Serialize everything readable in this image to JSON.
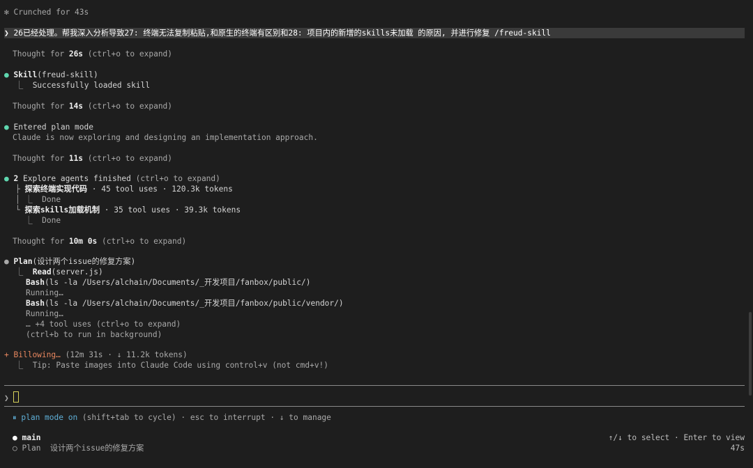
{
  "status_top": {
    "icon": "✻",
    "text": "Crunched for 43s"
  },
  "user_prompt": {
    "prompt_symbol": "❯",
    "text": "26已经处理。帮我深入分析导致27: 终端无法复制粘贴,和原生的终端有区别和28: 项目内的新增的skills未加载 的原因, 并进行修复 /freud-skill"
  },
  "thought1": {
    "pre": "Thought for ",
    "dur": "26s",
    "post": " (ctrl+o to expand)"
  },
  "skill": {
    "bullet": "●",
    "name": "Skill",
    "arg": "(freud-skill)",
    "result": "Successfully loaded skill"
  },
  "thought2": {
    "pre": "Thought for ",
    "dur": "14s",
    "post": " (ctrl+o to expand)"
  },
  "plan_mode": {
    "bullet": "●",
    "title": "Entered plan mode",
    "desc": "Claude is now exploring and designing an implementation approach."
  },
  "thought3": {
    "pre": "Thought for ",
    "dur": "11s",
    "post": " (ctrl+o to expand)"
  },
  "agents": {
    "bullet": "●",
    "count": "2",
    "title": " Explore agents finished",
    "hint": " (ctrl+o to expand)",
    "items": [
      {
        "name": "探索终端实现代码",
        "stats": " · 45 tool uses · 120.3k tokens",
        "status": "Done"
      },
      {
        "name": "探索skills加载机制",
        "stats": " · 35 tool uses · 39.3k tokens",
        "status": "Done"
      }
    ]
  },
  "thought4": {
    "pre": "Thought for ",
    "dur": "10m 0s",
    "post": " (ctrl+o to expand)"
  },
  "plan": {
    "bullet": "●",
    "name": "Plan",
    "arg": "(设计两个issue的修复方案)",
    "steps": [
      {
        "tool": "Read",
        "arg": "(server.js)"
      },
      {
        "tool": "Bash",
        "arg": "(ls -la /Users/alchain/Documents/_开发项目/fanbox/public/)"
      },
      {
        "status": "Running…"
      },
      {
        "tool": "Bash",
        "arg": "(ls -la /Users/alchain/Documents/_开发项目/fanbox/public/vendor/)"
      },
      {
        "status": "Running…"
      }
    ],
    "more": "… +4 tool uses (ctrl+o to expand)",
    "background": "(ctrl+b to run in background)"
  },
  "spinner": {
    "icon": "+",
    "word": "Billowing…",
    "stats": " (12m 31s · ↓ 11.2k tokens)",
    "tip": "Tip: Paste images into Claude Code using control+v (not cmd+v!)"
  },
  "input": {
    "prompt_symbol": "❯"
  },
  "mode_line": {
    "icon": "⏸",
    "mode": "plan mode on",
    "hint": " (shift+tab to cycle) · esc to interrupt · ↓ to manage"
  },
  "tasks": {
    "main_bullet": "●",
    "main_label": "main",
    "plan_bullet": "○",
    "plan_label": "Plan  设计两个issue的修复方案",
    "select_hint": "↑/↓ to select · Enter to view",
    "elapsed": "47s"
  },
  "colors": {
    "background": "#1e1e1e",
    "accent_green": "#5fd7af",
    "accent_orange": "#e8875f",
    "plan_cyan": "#5fafd7"
  }
}
